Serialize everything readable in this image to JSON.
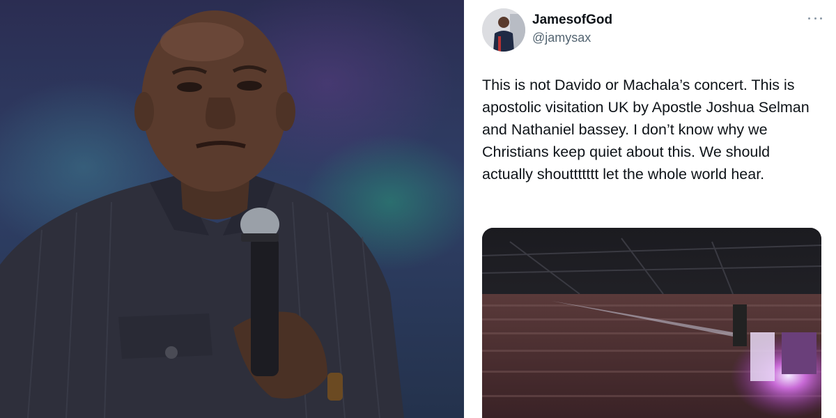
{
  "tweet": {
    "display_name": "JamesofGod",
    "handle": "@jamysax",
    "text": "This is not Davido or Machala’s concert. This is apostolic visitation UK by Apostle Joshua Selman and Nathaniel bassey. I don’t know why we Christians keep quiet about this. We should actually shouttttttt let the whole world hear.",
    "more_icon": "more-dots-icon"
  },
  "photo": {
    "subject": "speaker-holding-microphone"
  },
  "media": {
    "subject": "arena-crowd"
  }
}
